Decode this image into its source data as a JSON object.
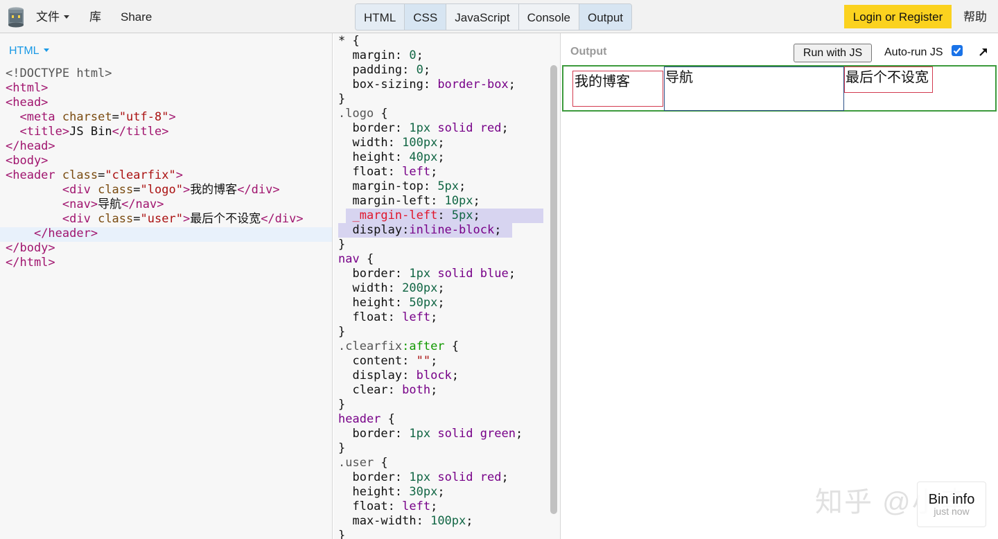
{
  "topbar": {
    "file_menu": "文件",
    "library": "库",
    "share": "Share",
    "tabs": [
      "HTML",
      "CSS",
      "JavaScript",
      "Console",
      "Output"
    ],
    "login": "Login or Register",
    "help": "帮助",
    "logo_icon": "jsbin-logo-icon"
  },
  "html_panel": {
    "label": "HTML",
    "lines": [
      [
        [
          "<!DOCTYPE html>",
          "doc"
        ]
      ],
      [
        [
          "<html>",
          "tag"
        ]
      ],
      [
        [
          "<head>",
          "tag"
        ]
      ],
      [
        [
          "  ",
          "text"
        ],
        [
          "<meta ",
          "tag"
        ],
        [
          "charset",
          "attr"
        ],
        [
          "=",
          "text"
        ],
        [
          "\"utf-8\"",
          "str"
        ],
        [
          ">",
          "tag"
        ]
      ],
      [
        [
          "  ",
          "text"
        ],
        [
          "<title>",
          "tag"
        ],
        [
          "JS Bin",
          "text"
        ],
        [
          "</title>",
          "tag"
        ]
      ],
      [
        [
          "</head>",
          "tag"
        ]
      ],
      [
        [
          "<body>",
          "tag"
        ]
      ],
      [
        [
          "<header ",
          "tag"
        ],
        [
          "class",
          "attr"
        ],
        [
          "=",
          "text"
        ],
        [
          "\"clearfix\"",
          "str"
        ],
        [
          ">",
          "tag"
        ]
      ],
      [
        [
          "        ",
          "text"
        ],
        [
          "<div ",
          "tag"
        ],
        [
          "class",
          "attr"
        ],
        [
          "=",
          "text"
        ],
        [
          "\"logo\"",
          "str"
        ],
        [
          ">",
          "tag"
        ],
        [
          "我的博客",
          "text"
        ],
        [
          "</div>",
          "tag"
        ]
      ],
      [
        [
          "        ",
          "text"
        ],
        [
          "<nav>",
          "tag"
        ],
        [
          "导航",
          "text"
        ],
        [
          "</nav>",
          "tag"
        ]
      ],
      [
        [
          "        ",
          "text"
        ],
        [
          "<div ",
          "tag"
        ],
        [
          "class",
          "attr"
        ],
        [
          "=",
          "text"
        ],
        [
          "\"user\"",
          "str"
        ],
        [
          ">",
          "tag"
        ],
        [
          "最后个不设宽",
          "text"
        ],
        [
          "</div>",
          "tag"
        ]
      ],
      [
        [
          "    ",
          "text"
        ],
        [
          "</header>",
          "tag"
        ]
      ],
      [
        [
          "</body>",
          "tag"
        ]
      ],
      [
        [
          "</html>",
          "tag"
        ]
      ]
    ]
  },
  "css_panel": {
    "lines": [
      [
        [
          "* {",
          "punc"
        ]
      ],
      [
        [
          "  margin",
          "prop"
        ],
        [
          ": ",
          "punc"
        ],
        [
          "0",
          "num"
        ],
        [
          ";",
          "punc"
        ]
      ],
      [
        [
          "  padding",
          "prop"
        ],
        [
          ": ",
          "punc"
        ],
        [
          "0",
          "num"
        ],
        [
          ";",
          "punc"
        ]
      ],
      [
        [
          "  box-sizing",
          "prop"
        ],
        [
          ": ",
          "punc"
        ],
        [
          "border-box",
          "kw"
        ],
        [
          ";",
          "punc"
        ]
      ],
      [
        [
          "}",
          "punc"
        ]
      ],
      [
        [
          ".logo",
          "sel"
        ],
        [
          " {",
          "punc"
        ]
      ],
      [
        [
          "  border",
          "prop"
        ],
        [
          ": ",
          "punc"
        ],
        [
          "1px",
          "num"
        ],
        [
          " ",
          "punc"
        ],
        [
          "solid",
          "kw"
        ],
        [
          " ",
          "punc"
        ],
        [
          "red",
          "kw"
        ],
        [
          ";",
          "punc"
        ]
      ],
      [
        [
          "  width",
          "prop"
        ],
        [
          ": ",
          "punc"
        ],
        [
          "100px",
          "num"
        ],
        [
          ";",
          "punc"
        ]
      ],
      [
        [
          "  height",
          "prop"
        ],
        [
          ": ",
          "punc"
        ],
        [
          "40px",
          "num"
        ],
        [
          ";",
          "punc"
        ]
      ],
      [
        [
          "  float",
          "prop"
        ],
        [
          ": ",
          "punc"
        ],
        [
          "left",
          "kw"
        ],
        [
          ";",
          "punc"
        ]
      ],
      [
        [
          "  margin-top",
          "prop"
        ],
        [
          ": ",
          "punc"
        ],
        [
          "5px",
          "num"
        ],
        [
          ";",
          "punc"
        ]
      ],
      [
        [
          "  margin-left",
          "prop"
        ],
        [
          ": ",
          "punc"
        ],
        [
          "10px",
          "num"
        ],
        [
          ";",
          "punc"
        ]
      ],
      [
        [
          "  ",
          "punc"
        ],
        [
          "_margin-left",
          "hack"
        ],
        [
          ": ",
          "punc"
        ],
        [
          "5px",
          "num"
        ],
        [
          ";",
          "punc"
        ]
      ],
      [
        [
          "  display",
          "prop"
        ],
        [
          ":",
          "punc"
        ],
        [
          "inline-block",
          "kw"
        ],
        [
          ";",
          "punc"
        ]
      ],
      [
        [
          "}",
          "punc"
        ]
      ],
      [
        [
          "nav",
          "kw"
        ],
        [
          " {",
          "punc"
        ]
      ],
      [
        [
          "  border",
          "prop"
        ],
        [
          ": ",
          "punc"
        ],
        [
          "1px",
          "num"
        ],
        [
          " ",
          "punc"
        ],
        [
          "solid",
          "kw"
        ],
        [
          " ",
          "punc"
        ],
        [
          "blue",
          "kw"
        ],
        [
          ";",
          "punc"
        ]
      ],
      [
        [
          "  width",
          "prop"
        ],
        [
          ": ",
          "punc"
        ],
        [
          "200px",
          "num"
        ],
        [
          ";",
          "punc"
        ]
      ],
      [
        [
          "  height",
          "prop"
        ],
        [
          ": ",
          "punc"
        ],
        [
          "50px",
          "num"
        ],
        [
          ";",
          "punc"
        ]
      ],
      [
        [
          "  float",
          "prop"
        ],
        [
          ": ",
          "punc"
        ],
        [
          "left",
          "kw"
        ],
        [
          ";",
          "punc"
        ]
      ],
      [
        [
          "}",
          "punc"
        ]
      ],
      [
        [
          ".clearfix",
          "sel"
        ],
        [
          ":after",
          "pseudo"
        ],
        [
          " {",
          "punc"
        ]
      ],
      [
        [
          "  content",
          "prop"
        ],
        [
          ": ",
          "punc"
        ],
        [
          "\"\"",
          "str"
        ],
        [
          ";",
          "punc"
        ]
      ],
      [
        [
          "  display",
          "prop"
        ],
        [
          ": ",
          "punc"
        ],
        [
          "block",
          "kw"
        ],
        [
          ";",
          "punc"
        ]
      ],
      [
        [
          "  clear",
          "prop"
        ],
        [
          ": ",
          "punc"
        ],
        [
          "both",
          "kw"
        ],
        [
          ";",
          "punc"
        ]
      ],
      [
        [
          "}",
          "punc"
        ]
      ],
      [
        [
          "header",
          "kw"
        ],
        [
          " {",
          "punc"
        ]
      ],
      [
        [
          "  border",
          "prop"
        ],
        [
          ": ",
          "punc"
        ],
        [
          "1px",
          "num"
        ],
        [
          " ",
          "punc"
        ],
        [
          "solid",
          "kw"
        ],
        [
          " ",
          "punc"
        ],
        [
          "green",
          "kw"
        ],
        [
          ";",
          "punc"
        ]
      ],
      [
        [
          "}",
          "punc"
        ]
      ],
      [
        [
          ".user",
          "sel"
        ],
        [
          " {",
          "punc"
        ]
      ],
      [
        [
          "  border",
          "prop"
        ],
        [
          ": ",
          "punc"
        ],
        [
          "1px",
          "num"
        ],
        [
          " ",
          "punc"
        ],
        [
          "solid",
          "kw"
        ],
        [
          " ",
          "punc"
        ],
        [
          "red",
          "kw"
        ],
        [
          ";",
          "punc"
        ]
      ],
      [
        [
          "  height",
          "prop"
        ],
        [
          ": ",
          "punc"
        ],
        [
          "30px",
          "num"
        ],
        [
          ";",
          "punc"
        ]
      ],
      [
        [
          "  float",
          "prop"
        ],
        [
          ": ",
          "punc"
        ],
        [
          "left",
          "kw"
        ],
        [
          ";",
          "punc"
        ]
      ],
      [
        [
          "  max-width",
          "prop"
        ],
        [
          ": ",
          "punc"
        ],
        [
          "100px",
          "num"
        ],
        [
          ";",
          "punc"
        ]
      ],
      [
        [
          "}",
          "punc"
        ]
      ]
    ]
  },
  "output_panel": {
    "label": "Output",
    "run_button": "Run with JS",
    "autorun_label": "Auto-run JS",
    "autorun_checked": true,
    "popout_icon": "popout-arrow-icon",
    "demo": {
      "logo_text": "我的博客",
      "nav_text": "导航",
      "user_text": "最后个不设宽"
    },
    "watermark": "知乎 @小李",
    "bin_info": {
      "title": "Bin info",
      "subtitle": "just now"
    }
  }
}
